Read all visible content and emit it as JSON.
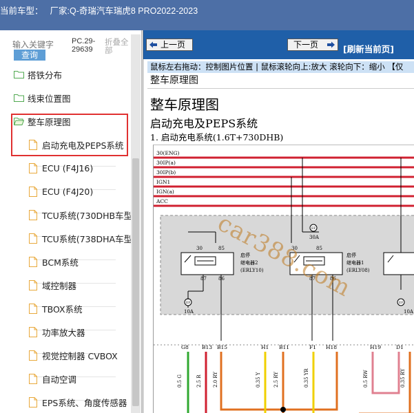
{
  "window": {
    "title_label": "当前车型：",
    "title_value": "厂家:Q-奇瑞汽车瑞虎8 PRO2022-2023"
  },
  "sidebar": {
    "search": {
      "placeholder": "输入关键字",
      "button_label": "查询"
    },
    "pc_code": "PC.29-29639",
    "collapse_label": "折叠全部",
    "items": [
      {
        "label": "搭铁分布",
        "icon": "folder-icon",
        "level": 1
      },
      {
        "label": "线束位置图",
        "icon": "folder-icon",
        "level": 1
      },
      {
        "label": "整车原理图",
        "icon": "folder-open-icon",
        "level": 1
      },
      {
        "label": "启动充电及PEPS系统",
        "icon": "document-icon",
        "level": 2
      },
      {
        "label": "ECU (F4J16)",
        "icon": "document-icon",
        "level": 2
      },
      {
        "label": "ECU (F4J20)",
        "icon": "document-icon",
        "level": 2
      },
      {
        "label": "TCU系统(730DHB车型",
        "icon": "document-icon",
        "level": 2
      },
      {
        "label": "TCU系统(738DHA车型",
        "icon": "document-icon",
        "level": 2
      },
      {
        "label": "BCM系统",
        "icon": "document-icon",
        "level": 2
      },
      {
        "label": "域控制器",
        "icon": "document-icon",
        "level": 2
      },
      {
        "label": "TBOX系统",
        "icon": "document-icon",
        "level": 2
      },
      {
        "label": "功率放大器",
        "icon": "document-icon",
        "level": 2
      },
      {
        "label": "视觉控制器 CVBOX",
        "icon": "document-icon",
        "level": 2
      },
      {
        "label": "自动空调",
        "icon": "document-icon",
        "level": 2
      },
      {
        "label": "EPS系统、角度传感器",
        "icon": "document-icon",
        "level": 2
      }
    ]
  },
  "content": {
    "nav": {
      "prev_label": "上一页",
      "next_label": "下一页",
      "refresh_label": "[刷新当前页]"
    },
    "hint_text": "鼠标左右拖动：控制图片位置 | 鼠标滚轮向上:放大  滚轮向下：缩小 【仅",
    "page_heading": "整车原理图",
    "page_title": "整车原理图",
    "section_title": "启动充电及PEPS系统",
    "subsection_title": "1. 启动充电系统(1.6T+730DHB)"
  },
  "diagram": {
    "rails": [
      "30(ENG)",
      "30IP(a)",
      "30IP(b)",
      "IGN1",
      "IGN(a)",
      "ACC"
    ],
    "relay_left": {
      "name": "启停",
      "name2": "继电器2",
      "code": "(ERLY10)",
      "pins": [
        "30",
        "85",
        "87",
        "86"
      ]
    },
    "relay_right": {
      "name": "启停",
      "name2": "继电器1",
      "code": "(ERLY08)",
      "pins": [
        "30",
        "85",
        "87",
        "86"
      ]
    },
    "fuses": [
      {
        "id": "EF",
        "rating": "10A"
      },
      {
        "id": "EF",
        "rating": "30A"
      },
      {
        "id": "EF",
        "rating": "10A"
      }
    ],
    "connector_pins": [
      "G8",
      "B13",
      "B15",
      "H1",
      "B11",
      "F1",
      "H18",
      "H19",
      "D1"
    ],
    "wires": [
      "0.5 G",
      "2.5 R",
      "2.0 RY",
      "0.35 Y",
      "2.5 RY",
      "0.35 YR",
      "0.5 RW",
      "0.35 RY"
    ],
    "watermark": "car388.com",
    "colors": {
      "rail": "#d02030",
      "green": "#30a830",
      "orange": "#e07020",
      "yellow": "#f0d000",
      "pink": "#e08090",
      "nav_blue": "#1f5fa8",
      "title_blue": "#4d6fa6",
      "highlight": "#e03030"
    }
  }
}
